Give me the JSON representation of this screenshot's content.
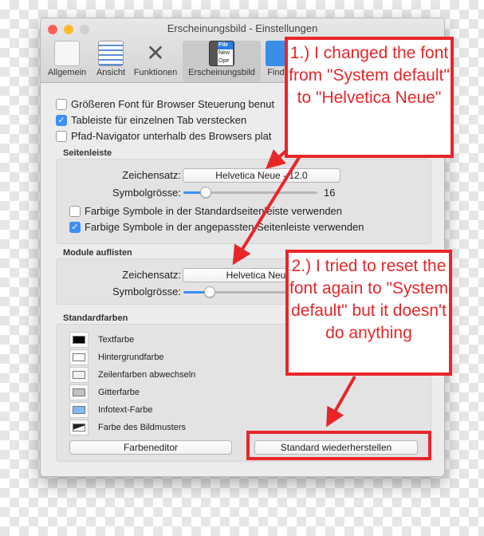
{
  "window": {
    "title": "Erscheinungsbild - Einstellungen"
  },
  "toolbar": [
    {
      "label": "Allgemein",
      "icon": "switch-icon"
    },
    {
      "label": "Ansicht",
      "icon": "view-icon"
    },
    {
      "label": "Funktionen",
      "icon": "tools-icon"
    },
    {
      "label": "Erscheinungsbild",
      "icon": "appearance-icon",
      "selected": true,
      "icon_text": [
        "File",
        "New",
        "Ope"
      ]
    },
    {
      "label": "Finde",
      "icon": "finder-icon"
    }
  ],
  "general": [
    {
      "label": "Größeren Font für Browser Steuerung benut",
      "checked": false
    },
    {
      "label": "Tableiste für einzelnen Tab verstecken",
      "checked": true
    },
    {
      "label": "Pfad-Navigator unterhalb des Browsers plat",
      "checked": false
    }
  ],
  "sidebar": {
    "header": "Seitenleiste",
    "font_label": "Zeichensatz:",
    "font_value": "Helvetica Neue - 12.0",
    "size_label": "Symbolgrösse:",
    "size_value": "16",
    "checks": [
      {
        "label": "Farbige Symbole in der Standardseitenleiste verwenden",
        "checked": false
      },
      {
        "label": "Farbige Symbole in der angepassten Seitenleiste verwenden",
        "checked": true
      }
    ]
  },
  "modules": {
    "header": "Module auflisten",
    "font_label": "Zeichensatz:",
    "font_value": "Helvetica Neue -",
    "size_label": "Symbolgrösse:"
  },
  "colors": {
    "header": "Standardfarben",
    "items": [
      {
        "label": "Textfarbe",
        "color": "#000000"
      },
      {
        "label": "Hintergrundfarbe",
        "color": "#ffffff"
      },
      {
        "label": "Zeilenfarben abwechseln",
        "color": "#f2f2f2"
      },
      {
        "label": "Gitterfarbe",
        "color": "#c0c0c0"
      },
      {
        "label": "Infotext-Farbe",
        "color": "#7dbcf7"
      },
      {
        "label": "Farbe des Bildmusters",
        "color": "#222222"
      }
    ],
    "editor_button": "Farbeneditor",
    "reset_button": "Standard wiederherstellen"
  },
  "annotations": {
    "note1": "1.) I changed the font from \"System default\" to \"Helvetica Neue\"",
    "note2": "2.) I tried to reset the font again to \"System default\" but it doesn't do anything",
    "accent": "#e8262a"
  }
}
